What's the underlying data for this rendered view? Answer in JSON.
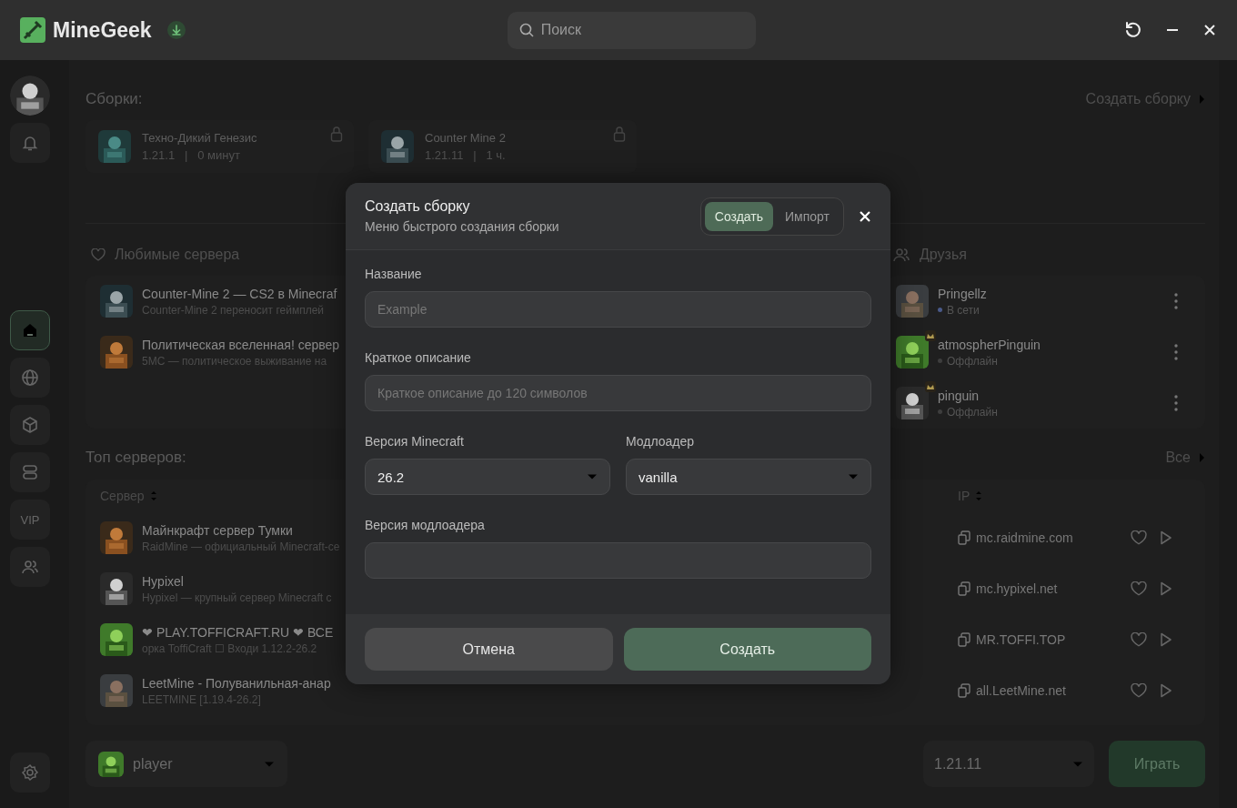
{
  "app": {
    "name": "MineGeek"
  },
  "search": {
    "placeholder": "Поиск"
  },
  "sidebar": {
    "items": [
      {
        "kind": "home",
        "selected": true
      },
      {
        "kind": "globe",
        "selected": false
      },
      {
        "kind": "cube",
        "selected": false
      },
      {
        "kind": "servers",
        "selected": false
      },
      {
        "kind": "text",
        "label": "VIP",
        "selected": false
      },
      {
        "kind": "friends",
        "selected": false
      }
    ]
  },
  "builds": {
    "title": "Сборки:",
    "action": "Создать сборку",
    "separator": "|",
    "items": [
      {
        "name": "Техно-Дикий Генезис",
        "version": "1.21.1",
        "playtime": "0 минут",
        "locked": true
      },
      {
        "name": "Counter Mine 2",
        "version": "1.21.11",
        "playtime": "1 ч.",
        "locked": true
      }
    ]
  },
  "favorites": {
    "title": "Любимые сервера",
    "items": [
      {
        "title": "Counter-Mine 2 — CS2 в Minecraf",
        "description": "Counter-Mine 2 переносит геймплей"
      },
      {
        "title": "Политическая вселенная! сервер",
        "description": "5MC — политическое выживание на"
      }
    ]
  },
  "friends": {
    "title": "Друзья",
    "items": [
      {
        "name": "Pringellz",
        "status": "В сети",
        "online": true,
        "crown": false
      },
      {
        "name": "atmospherPinguin",
        "status": "Оффлайн",
        "online": false,
        "crown": true
      },
      {
        "name": "pinguin",
        "status": "Оффлайн",
        "online": false,
        "crown": true
      }
    ]
  },
  "top_servers": {
    "title": "Топ серверов:",
    "action": "Все",
    "columns": [
      "Сервер",
      "IP"
    ],
    "rows": [
      {
        "title": "Майнкрафт сервер Тумки",
        "description": "RaidMine — официальный Minecraft-се",
        "ip": "mc.raidmine.com"
      },
      {
        "title": "Hypixel",
        "description": "Hypixel — крупный сервер Minecraft с",
        "ip": "mc.hypixel.net"
      },
      {
        "title": "❤ PLAY.TOFFICRAFT.RU ❤ ВСЕ",
        "description": "орка ToffiCraft ☐ Входи 1.12.2-26.2",
        "ip": "MR.TOFFI.TOP"
      },
      {
        "title": "LeetMine - Полуванильная-анар",
        "description": "LEETMINE [1.19.4-26.2]",
        "ip": "all.LeetMine.net"
      }
    ]
  },
  "bottom": {
    "profile": "player",
    "version": "1.21.11",
    "play": "Играть"
  },
  "modal": {
    "title": "Создать сборку",
    "subtitle": "Меню быстрого создания сборки",
    "tabs": [
      {
        "label": "Создать",
        "selected": true
      },
      {
        "label": "Импорт",
        "selected": false
      }
    ],
    "fields": [
      {
        "kind": "text",
        "label": "Название",
        "placeholder": "Example"
      },
      {
        "kind": "text",
        "label": "Краткое описание",
        "placeholder": "Краткое описание до 120 символов"
      },
      {
        "kind": "select",
        "label": "Версия Minecraft",
        "value": "26.2"
      },
      {
        "kind": "select",
        "label": "Модлоадер",
        "value": "vanilla"
      },
      {
        "kind": "text",
        "label": "Версия модлоадера"
      }
    ],
    "buttons": [
      {
        "label": "Отмена",
        "kind": "secondary"
      },
      {
        "label": "Создать",
        "kind": "primary"
      }
    ]
  }
}
